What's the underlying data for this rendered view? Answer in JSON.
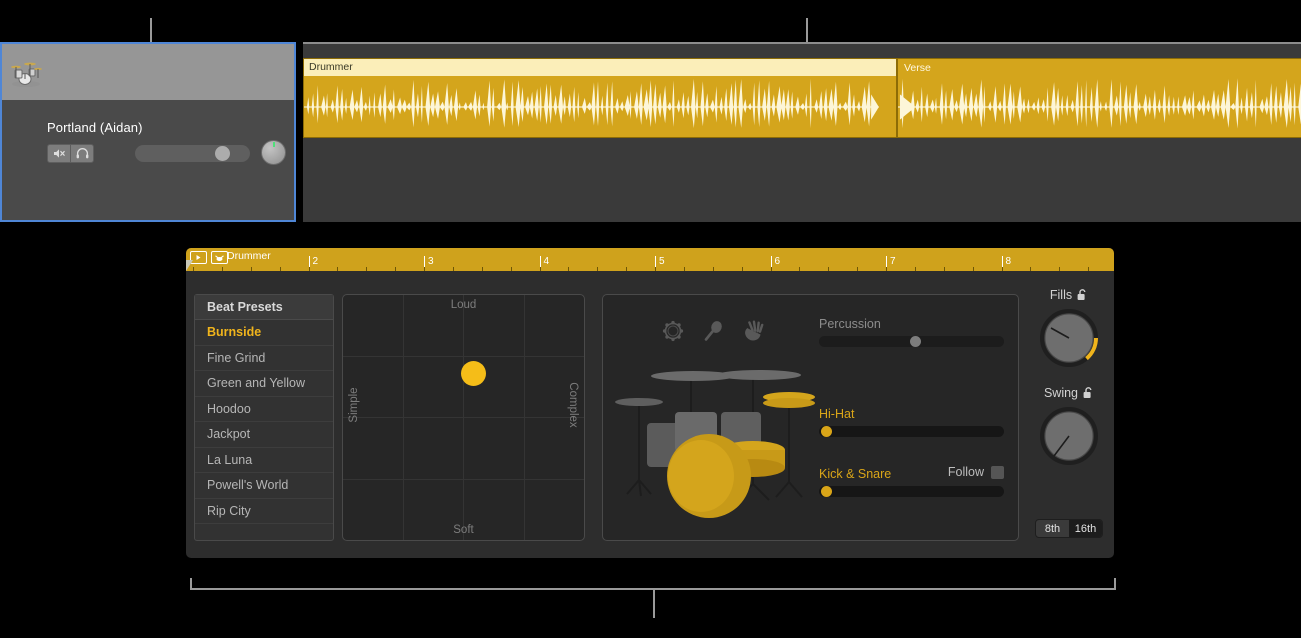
{
  "track": {
    "name": "Portland (Aidan)",
    "kit_icon": "drum-kit-icon",
    "mute_icon": "mute-speaker-icon",
    "solo_icon": "headphones-icon",
    "volume_value": 70,
    "pan_value": 0
  },
  "regions": [
    {
      "title": "Drummer",
      "selected": true
    },
    {
      "title": "Verse",
      "selected": false
    }
  ],
  "editor": {
    "ruler": {
      "label": "Drummer",
      "play_icon": "play-button-icon",
      "drummer_icon": "drummer-region-icon",
      "bars": [
        "2",
        "3",
        "4",
        "5",
        "6",
        "7",
        "8"
      ]
    },
    "presets": {
      "header": "Beat Presets",
      "items": [
        {
          "label": "Burnside",
          "selected": true
        },
        {
          "label": "Fine Grind",
          "selected": false
        },
        {
          "label": "Green and Yellow",
          "selected": false
        },
        {
          "label": "Hoodoo",
          "selected": false
        },
        {
          "label": "Jackpot",
          "selected": false
        },
        {
          "label": "La Luna",
          "selected": false
        },
        {
          "label": "Powell's World",
          "selected": false
        },
        {
          "label": "Rip City",
          "selected": false
        }
      ]
    },
    "xy_pad": {
      "top_label": "Loud",
      "bottom_label": "Soft",
      "left_label": "Simple",
      "right_label": "Complex",
      "puck_x_pct": 49,
      "puck_y_pct": 28
    },
    "kit_panel": {
      "percussion_icons": [
        "tambourine-icon",
        "shaker-icon",
        "clap-hand-icon"
      ],
      "sliders": [
        {
          "label": "Percussion",
          "value_pct": 50,
          "active": false
        },
        {
          "label": "Hi-Hat",
          "value_pct": 3,
          "active": true
        },
        {
          "label": "Kick & Snare",
          "value_pct": 3,
          "active": true
        }
      ],
      "follow": {
        "label": "Follow",
        "checked": false
      }
    },
    "knobs": [
      {
        "label": "Fills",
        "lock_icon": "unlocked-padlock-icon",
        "angle_deg": 75,
        "arc": true
      },
      {
        "label": "Swing",
        "lock_icon": "unlocked-padlock-icon",
        "angle_deg": -145,
        "arc": false
      }
    ],
    "swing_division": {
      "options": [
        {
          "label": "8th",
          "selected": false
        },
        {
          "label": "16th",
          "selected": true
        }
      ]
    }
  },
  "colors": {
    "accent_yellow": "#f0b41c",
    "region_yellow": "#d4a51c",
    "selection_blue": "#4f86d6",
    "panel_dark": "#262626"
  }
}
